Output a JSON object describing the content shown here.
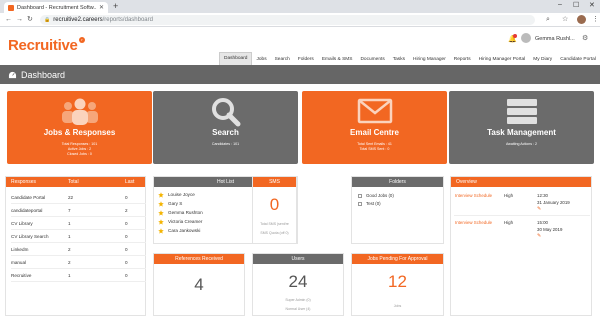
{
  "browser": {
    "tab_title": "Dashboard - Recruitment Softw...",
    "url_host": "recruitive2.careers",
    "url_path": "/reports/dashboard"
  },
  "header": {
    "logo": "Recruitive",
    "user_name": "Gemma Rushl...",
    "nav": [
      "Dashboard",
      "Jobs",
      "Search",
      "Folders",
      "Emails & SMS",
      "Documents",
      "Tasks",
      "Hiring Manager",
      "Reports",
      "Hiring Manager Portal",
      "My Diary",
      "Candidate Portal"
    ],
    "active_nav": "Dashboard"
  },
  "page_title": "Dashboard",
  "tiles": [
    {
      "title": "Jobs & Responses",
      "lines": [
        "Total Responses : 101",
        "Active Jobs : 2",
        "Closed Jobs : 0"
      ],
      "color": "orange",
      "icon": "people-icon"
    },
    {
      "title": "Search",
      "lines": [
        "Candidates : 101"
      ],
      "color": "grey",
      "icon": "search-icon"
    },
    {
      "title": "Email Centre",
      "lines": [
        "Total Sent Emails : 41",
        "Total SMS Sent : 0"
      ],
      "color": "orange",
      "icon": "envelope-icon"
    },
    {
      "title": "Task Management",
      "lines": [
        "Awaiting Actions : 2"
      ],
      "color": "grey",
      "icon": "server-icon"
    }
  ],
  "sources": {
    "headers": [
      "Responses",
      "Total",
      "Last"
    ],
    "rows": [
      {
        "name": "Candidate Portal",
        "total": "22",
        "last": "0"
      },
      {
        "name": "candidateportal",
        "total": "7",
        "last": "2"
      },
      {
        "name": "CV Library",
        "total": "1",
        "last": "0"
      },
      {
        "name": "CV Library Search",
        "total": "1",
        "last": "0"
      },
      {
        "name": "LinkedIn",
        "total": "2",
        "last": "0"
      },
      {
        "name": "manual",
        "total": "2",
        "last": "0"
      },
      {
        "name": "Recruitive",
        "total": "1",
        "last": "0"
      }
    ]
  },
  "hotlist": {
    "title": "Hot List",
    "people": [
      "Louise Joyce",
      "Gary S",
      "Gemma Rushton",
      "Victoria Creamer",
      "Cara Jankowski"
    ]
  },
  "sms": {
    "title": "SMS",
    "value": "0",
    "line1": "Total SMS (sent/re",
    "line2": "SMS Quota (off 0)"
  },
  "folders": {
    "title": "Folders",
    "items": [
      "Good Jobs (0)",
      "Test (0)"
    ]
  },
  "overview": {
    "title": "Overview",
    "rows": [
      {
        "name": "Interview Schedule",
        "priority": "High",
        "time": "12:30",
        "date": "31 January 2019"
      },
      {
        "name": "Interview Schedule",
        "priority": "High",
        "time": "15:00",
        "date": "30 May 2019"
      }
    ]
  },
  "references": {
    "title": "References Received",
    "value": "4"
  },
  "users": {
    "title": "Users",
    "value": "24",
    "line1": "Super Admin (0)",
    "line2": "Normal User (4)"
  },
  "jobs_pending": {
    "title": "Jobs Pending For Approval",
    "value": "12",
    "line1": "Jobs"
  }
}
